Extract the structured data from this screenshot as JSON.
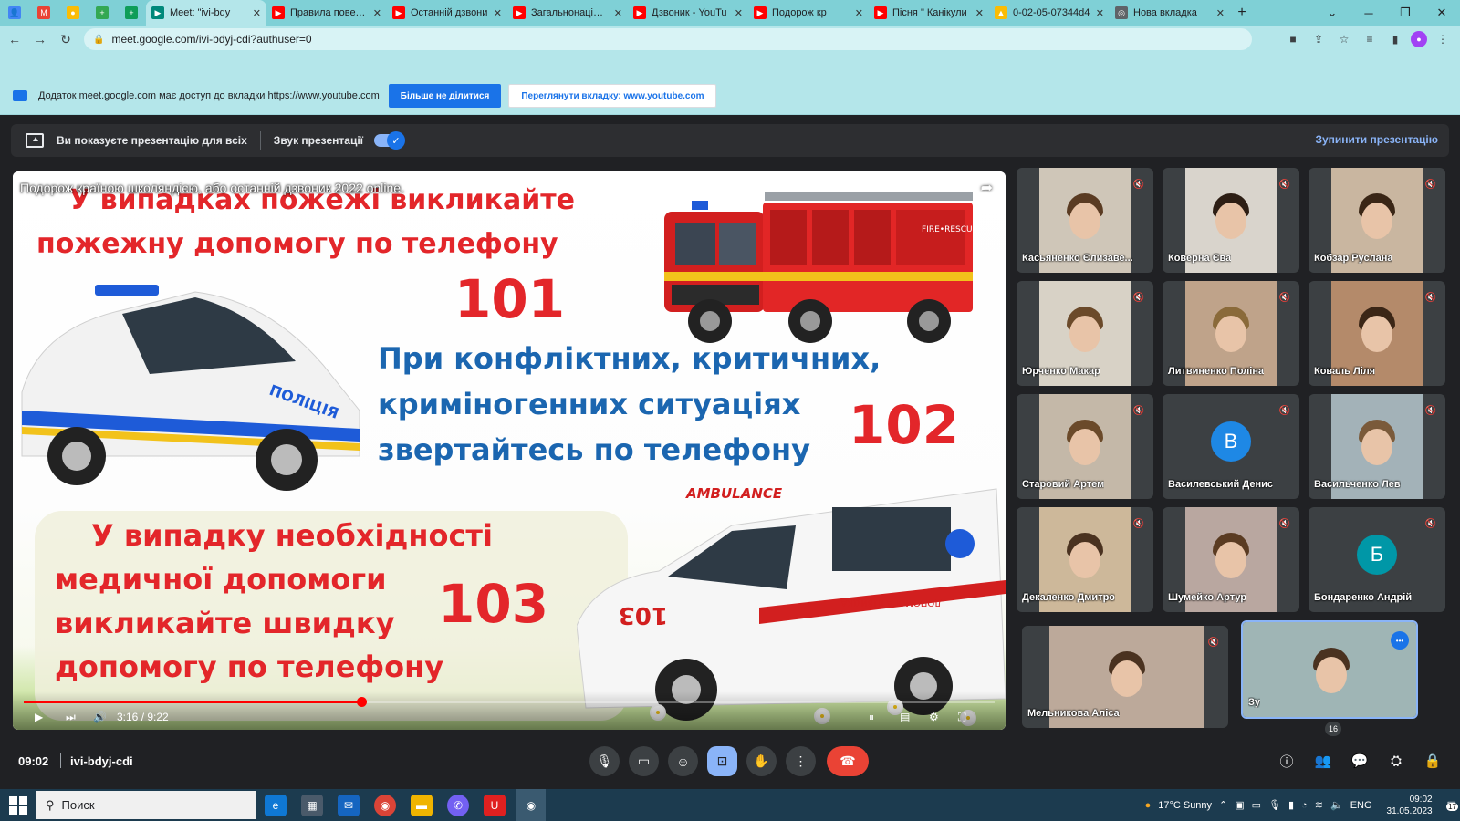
{
  "browser": {
    "tabs": [
      {
        "label": "",
        "color": "#4285f4",
        "pinned": true,
        "glyph": "👤"
      },
      {
        "label": "",
        "color": "#ea4335",
        "pinned": true,
        "glyph": "M"
      },
      {
        "label": "",
        "color": "#fbbc04",
        "pinned": true,
        "glyph": "●"
      },
      {
        "label": "",
        "color": "#34a853",
        "pinned": true,
        "glyph": "+"
      },
      {
        "label": "",
        "color": "#0f9d58",
        "pinned": true,
        "glyph": "+"
      },
      {
        "label": "Meet: \"ivi-bdy",
        "color": "#00897b",
        "active": true,
        "glyph": "▶"
      },
      {
        "label": "Правила поведін",
        "color": "#ff0000",
        "glyph": "▶"
      },
      {
        "label": "Останній дзвони",
        "color": "#ff0000",
        "glyph": "▶"
      },
      {
        "label": "Загальнонаціона",
        "color": "#ff0000",
        "glyph": "▶"
      },
      {
        "label": "Дзвоник - YouTu",
        "color": "#ff0000",
        "glyph": "▶"
      },
      {
        "label": "Подорож кр",
        "color": "#ff0000",
        "glyph": "▶"
      },
      {
        "label": "Пісня \" Канікули",
        "color": "#ff0000",
        "glyph": "▶"
      },
      {
        "label": "0-02-05-07344d4",
        "color": "#fbbc04",
        "glyph": "▲"
      },
      {
        "label": "Нова вкладка",
        "color": "#5f6368",
        "glyph": "◎"
      }
    ],
    "new_tab": "+",
    "url": "meet.google.com/ivi-bdyj-cdi?authuser=0"
  },
  "share_notice": {
    "message": "Додаток meet.google.com має доступ до вкладки https://www.youtube.com",
    "stop_sharing": "Більше не ділитися",
    "view_tab": "Переглянути вкладку: www.youtube.com"
  },
  "presentation_bar": {
    "status": "Ви показуєте презентацію для всіх",
    "audio_label": "Звук презентації",
    "stop_label": "Зупинити презентацію"
  },
  "video": {
    "title": "Подорож країною школяндією, або останній дзвоник 2022 online.",
    "time": "3:16 / 9:22",
    "progress": 0.348,
    "slide": {
      "fire_line1": "У випадках пожежі викликайте",
      "fire_line2": "пожежну допомогу по телефону",
      "fire_num": "101",
      "police_line1": "При конфліктних, критичних,",
      "police_line2": "криміногенних ситуаціях",
      "police_line3": "звертайтесь по телефону",
      "police_num": "102",
      "med_line1": "У випадку необхідності",
      "med_line2": "медичної допомоги",
      "med_line3": "викликайте швидку",
      "med_line4": "допомогу по телефону",
      "med_num": "103",
      "fire_truck_text": "FIRE•RESCUE",
      "police_car_text": "ПОЛІЦІЯ",
      "ambulance_text": "AMBULANCE",
      "ambulance_side": "ДОПОМОГА ШВИДКА",
      "ambulance_num": "103"
    }
  },
  "participants": [
    {
      "name": "Касьяненко Єлизаве...",
      "bg": "#cfc6b8"
    },
    {
      "name": "Коверна Єва",
      "bg": "#d9d4cc"
    },
    {
      "name": "Кобзар Руслана",
      "bg": "#c9b6a0"
    },
    {
      "name": "Юрченко Макар",
      "bg": "#d8d2c6"
    },
    {
      "name": "Литвиненко Поліна",
      "bg": "#bfa38a"
    },
    {
      "name": "Коваль Ліля",
      "bg": "#b48a6a"
    },
    {
      "name": "Старовий Артем",
      "bg": "#c4b8a8"
    },
    {
      "name": "Василевський Денис",
      "letter": "В",
      "color": "#1e88e5"
    },
    {
      "name": "Васильченко Лев",
      "bg": "#a3b2b8"
    },
    {
      "name": "Декаленко Дмитро",
      "bg": "#cdb89a"
    },
    {
      "name": "Шумейко Артур",
      "bg": "#b9a7a0"
    },
    {
      "name": "Бондаренко Андрій",
      "letter": "Б",
      "color": "#0097a7"
    },
    {
      "name": "Мельникова Аліса",
      "bg": "#bca99a"
    },
    {
      "name": "Зу",
      "bg": "#9fb5b5"
    }
  ],
  "meeting": {
    "time": "09:02",
    "code": "ivi-bdyj-cdi",
    "people_count": "16",
    "colors": {
      "end_call": "#ea4335",
      "present_active": "#8ab4f8"
    }
  },
  "taskbar": {
    "search": "Поиск",
    "weather": "17°C  Sunny",
    "lang": "ENG",
    "clock_time": "09:02",
    "clock_date": "31.05.2023",
    "notif_count": "17"
  }
}
